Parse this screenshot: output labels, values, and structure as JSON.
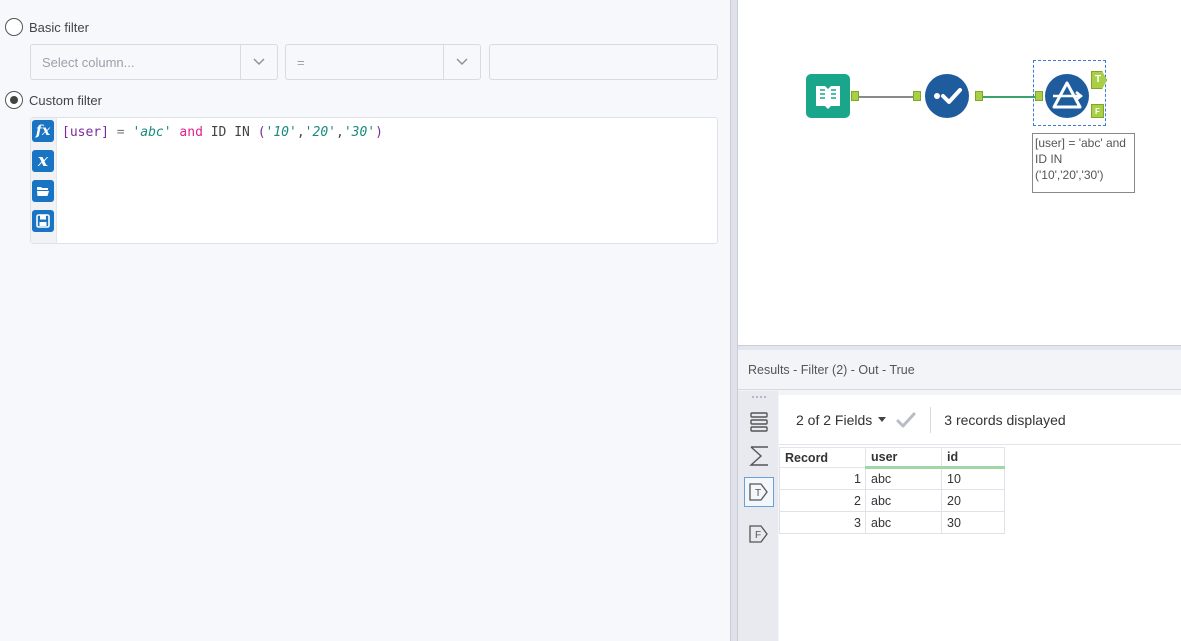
{
  "filter": {
    "basic_label": "Basic filter",
    "custom_label": "Custom filter",
    "selected": "custom",
    "column_placeholder": "Select column...",
    "operator_value": "=",
    "value_field": "",
    "expression": {
      "field": "[user]",
      "eq": "=",
      "str1": "'abc'",
      "kw": "and",
      "id": "ID",
      "in": "IN",
      "open": "(",
      "v1": "'10'",
      "v2": "'20'",
      "v3": "'30'",
      "comma": ",",
      "close": ")"
    },
    "gutter_icons": [
      "function-icon",
      "variable-icon",
      "open-folder-icon",
      "save-icon"
    ]
  },
  "canvas": {
    "annotation_lines": [
      "[user] = 'abc' and",
      "ID IN",
      "('10','20','30')"
    ],
    "filter_true_anchor": "T",
    "filter_false_anchor": "F",
    "tools": [
      "input-data-tool-icon",
      "select-tool-icon",
      "filter-tool-icon"
    ]
  },
  "results": {
    "header": "Results - Filter (2) - Out - True",
    "fields_label": "2 of 2 Fields",
    "records_label": "3 records displayed",
    "columns": [
      "Record",
      "user",
      "id"
    ],
    "rows": [
      {
        "record": "1",
        "user": "abc",
        "id": "10"
      },
      {
        "record": "2",
        "user": "abc",
        "id": "20"
      },
      {
        "record": "3",
        "user": "abc",
        "id": "30"
      }
    ],
    "side_icons": [
      "table-view-icon",
      "sigma-icon",
      "true-output-icon",
      "false-output-icon"
    ],
    "side_true_letter": "T",
    "side_false_letter": "F"
  },
  "colors": {
    "accent": "#1975c3",
    "tool_blue": "#1e5c9e",
    "input_green": "#1aa68a",
    "anchor_green": "#a8cf45"
  }
}
